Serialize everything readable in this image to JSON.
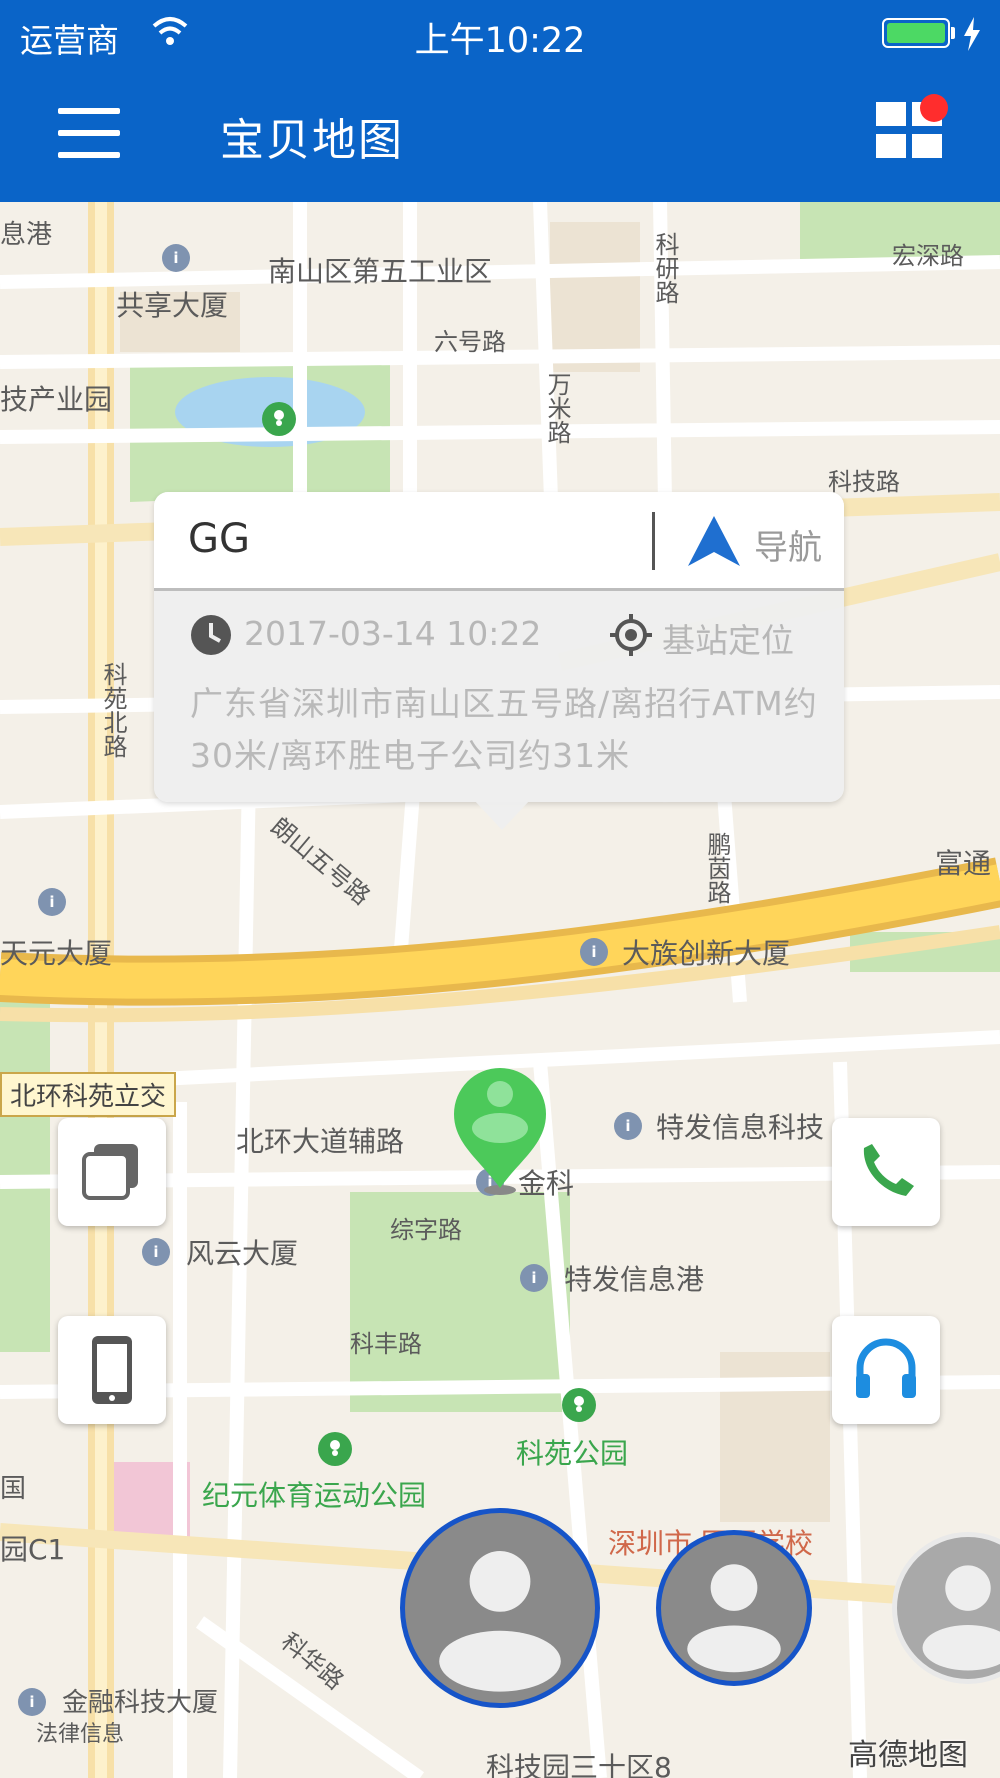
{
  "status_bar": {
    "carrier": "运营商",
    "time": "上午10:22"
  },
  "nav": {
    "title": "宝贝地图"
  },
  "map": {
    "labels": {
      "l1": "南山区第五工业区",
      "l2": "共享大厦",
      "l3": "六号路",
      "l4": "技产业园",
      "l5": "宏深路",
      "l6": "科技路",
      "l7": "科苑北路",
      "l8": "朗山五号路",
      "l9": "大族创新大厦",
      "l10": "天元大厦",
      "l11": "北环大道辅路",
      "l12": "特发信息科技",
      "l13": "金科",
      "l14": "综字路",
      "l15": "风云大厦",
      "l16": "特发信息港",
      "l17": "科丰路",
      "l18": "科苑公园",
      "l19": "纪元体育运动公园",
      "l20": "深圳市 国语学校",
      "l21": "金融科技大厦",
      "l22": "科华路",
      "l23": "科技园三十区8",
      "l24": "富通",
      "l25": "息港",
      "l26": "园C1",
      "l27": "国",
      "l28": "科研路",
      "l29": "鹏茵路",
      "l30": "北环科苑立交",
      "l31": "法律信息",
      "l32": "万米路"
    },
    "attribution": "高德地图"
  },
  "popup": {
    "name": "GG",
    "nav_label": "导航",
    "time": "2017-03-14 10:22",
    "loc_type": "基站定位",
    "address": "广东省深圳市南山区五号路/离招行ATM约30米/离环胜电子公司约31米"
  },
  "colors": {
    "brand": "#0a64c8",
    "marker": "#4cc95a",
    "avatar_border": "#1654c8"
  },
  "icons": {
    "menu": "hamburger-icon",
    "grid": "grid-icon",
    "navigate": "navigation-arrow-icon",
    "clock": "clock-icon",
    "locate": "locate-target-icon",
    "layers": "layers-icon",
    "phone": "phone-icon",
    "device": "mobile-device-icon",
    "listen": "headphones-icon",
    "avatar": "person-icon"
  }
}
